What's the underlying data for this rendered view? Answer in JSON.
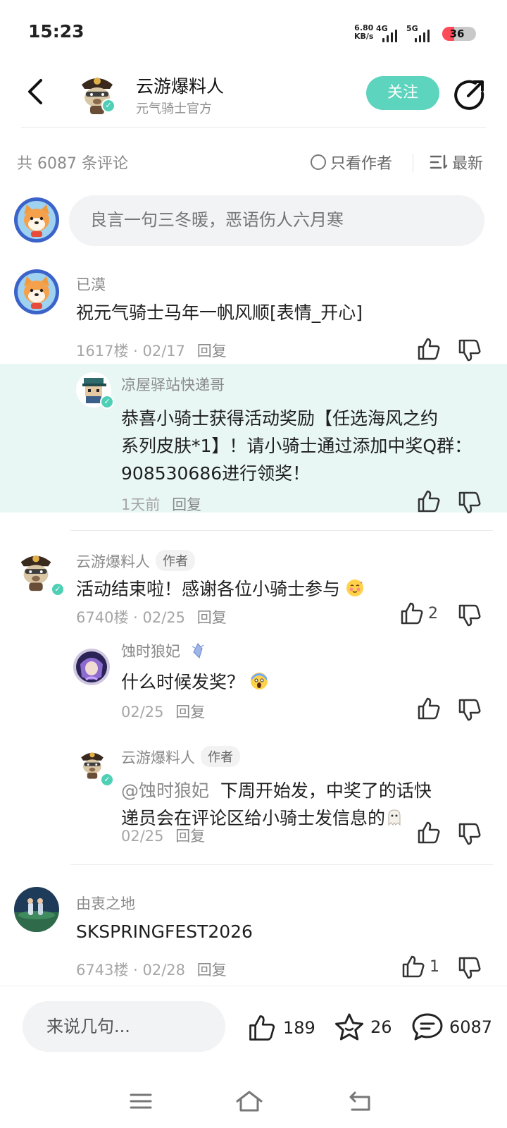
{
  "status_bar": {
    "time": "15:23",
    "net_speed_value": "6.80",
    "net_speed_unit": "KB/s",
    "signal_1_label": "4G",
    "signal_2_label": "5G",
    "battery": "36",
    "battery_level": 0.36,
    "battery_color": "#ff4b58"
  },
  "header": {
    "author_name": "云游爆料人",
    "author_subtitle": "元气骑士官方",
    "follow_label": "关注",
    "accent_color": "#5dd4bd"
  },
  "toolbar": {
    "comment_count_text": "共 6087 条评论",
    "only_author_label": "只看作者",
    "sort_label": "最新"
  },
  "composer": {
    "placeholder": "良言一句三冬暖，恶语伤人六月寒"
  },
  "comments": [
    {
      "user": "已漠",
      "text": "祝元气骑士马年一帆风顺[表情_开心]",
      "floor": "1617楼",
      "date": "02/17",
      "reply_label": "回复",
      "replies": [
        {
          "user": "凉屋驿站快递哥",
          "text_line1": "恭喜小骑士获得活动奖励【任选海风之约",
          "text_line2": "系列皮肤*1】！请小骑士通过添加中奖Q群：",
          "text_line3": "908530686进行领奖！",
          "time": "1天前",
          "reply_label": "回复"
        }
      ]
    },
    {
      "user": "云游爆料人",
      "tag": "作者",
      "text": "活动结束啦！感谢各位小骑士参与",
      "floor": "6740楼",
      "date": "02/25",
      "reply_label": "回复",
      "likes": "2",
      "replies": [
        {
          "user": "蚀时狼妃",
          "text": "什么时候发奖？",
          "time": "02/25",
          "reply_label": "回复"
        },
        {
          "user": "云游爆料人",
          "tag": "作者",
          "mention": "@蚀时狼妃",
          "text_line1": "下周开始发，中奖了的话快",
          "text_line2": "递员会在评论区给小骑士发信息的",
          "time": "02/25",
          "reply_label": "回复"
        }
      ]
    },
    {
      "user": "由衷之地",
      "text": "SKSPRINGFEST2026",
      "floor": "6743楼",
      "date": "02/28",
      "reply_label": "回复",
      "likes": "1"
    }
  ],
  "bottom_bar": {
    "input_placeholder": "来说几句...",
    "likes": "189",
    "favorites": "26",
    "comments": "6087"
  }
}
